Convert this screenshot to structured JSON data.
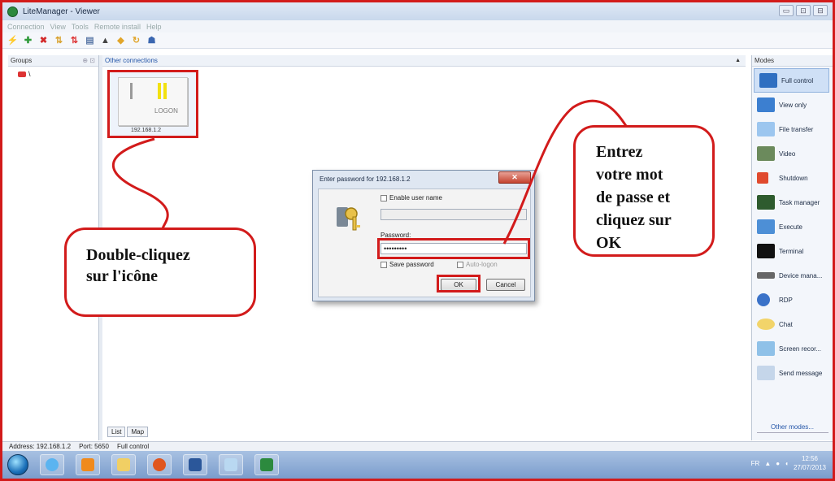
{
  "window": {
    "title": "LiteManager - Viewer",
    "buttons": [
      "▭",
      "⊡",
      "⊟"
    ]
  },
  "menu": {
    "items": [
      "Connection",
      "View",
      "Tools",
      "Remote install",
      "Help"
    ]
  },
  "left_panel": {
    "header": "Groups",
    "pin": "⊕ ⊡",
    "tree_item": "\\"
  },
  "center": {
    "header": "Other connections",
    "collapse": "▲",
    "tabs": [
      "List",
      "Map"
    ]
  },
  "tile": {
    "label": "LOGON",
    "ip": "192.168.1.2"
  },
  "dialog": {
    "title": "Enter password for 192.168.1.2",
    "close": "✕",
    "enable_user_name": "Enable user name",
    "password_label": "Password:",
    "password_value": "•••••••••",
    "save_password": "Save password",
    "auto_logon": "Auto-logon",
    "ok": "OK",
    "cancel": "Cancel"
  },
  "modes": {
    "header": "Modes",
    "items": [
      "Full control",
      "View only",
      "File transfer",
      "Video",
      "Shutdown",
      "Task manager",
      "Execute",
      "Terminal",
      "Device mana...",
      "RDP",
      "Chat",
      "Screen recor...",
      "Send message"
    ],
    "other": "Other modes..."
  },
  "status": {
    "address": "Address: 192.168.1.2",
    "port": "Port: 5650",
    "mode": "Full control"
  },
  "tray": {
    "lang": "FR",
    "time": "12:56",
    "date": "27/07/2013"
  },
  "callouts": {
    "left_line1": "Double-cliquez",
    "left_line2": "sur l'icône",
    "right_line1": "Entrez",
    "right_line2": "votre mot",
    "right_line3": "de passe et",
    "right_line4": "cliquez sur",
    "right_line5": "OK"
  },
  "colors": {
    "annotation": "#d21b1b",
    "titlebar": "#c9d8ec",
    "taskbar": "#7a9ccc"
  }
}
